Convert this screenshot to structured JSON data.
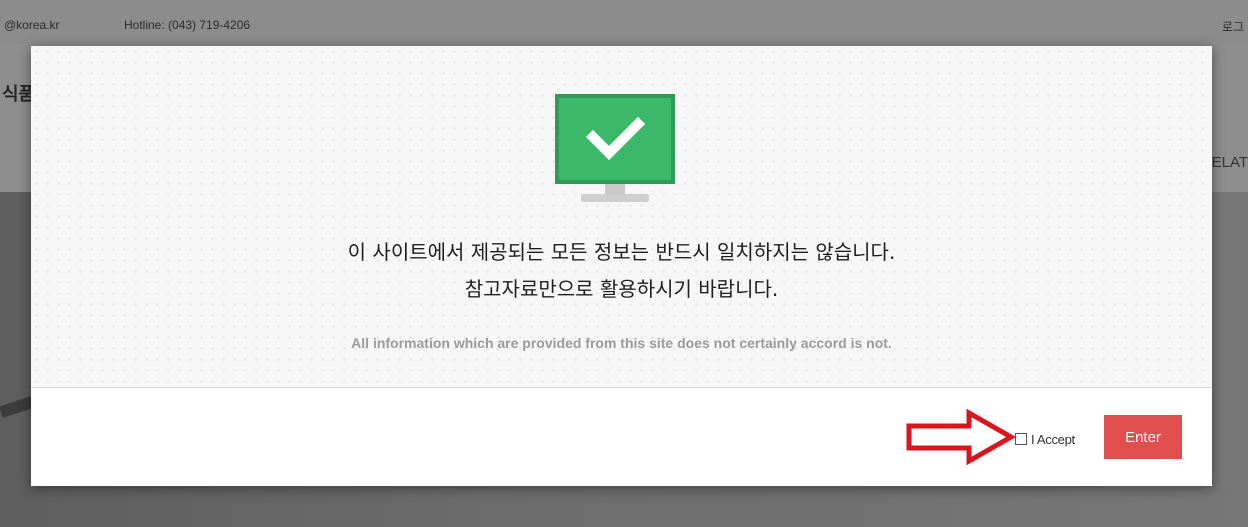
{
  "background_site": {
    "topbar": {
      "email_fragment": "@korea.kr",
      "hotline": "Hotline: (043) 719-4206",
      "login_fragment": "로그"
    },
    "header": {
      "logo_fragment": "식품",
      "nav_fragment": "ELAT"
    }
  },
  "modal": {
    "message_ko": [
      "이 사이트에서 제공되는 모든 정보는 반드시 일치하지는 않습니다.",
      "참고자료만으로 활용하시기 바랍니다."
    ],
    "message_en": "All information which are provided from this site does not certainly accord is not.",
    "icon": "monitor-checkmark-icon",
    "accept_label": "I Accept",
    "accept_checked": false,
    "enter_label": "Enter",
    "annotation": "red-arrow-icon"
  },
  "colors": {
    "monitor_screen": "#3cb86a",
    "enter_button": "#e04e4e",
    "annotation_arrow": "#d9161e"
  }
}
